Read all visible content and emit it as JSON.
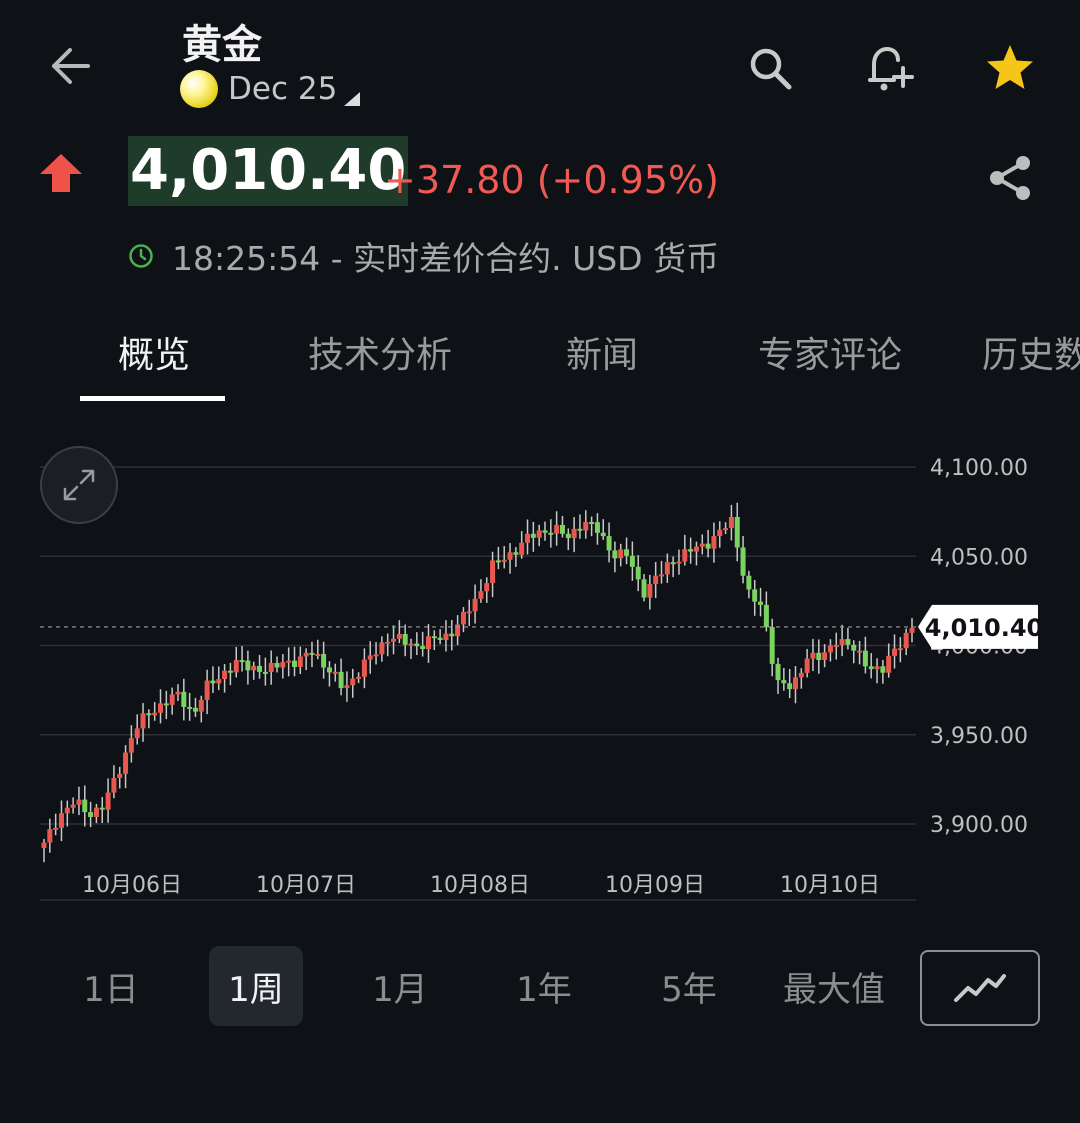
{
  "header": {
    "title": "黄金",
    "contract": "Dec 25",
    "icons": [
      "back-arrow-icon",
      "search-icon",
      "add-alert-icon",
      "star-icon"
    ]
  },
  "quote": {
    "price": "4,010.40",
    "change": "+37.80 (+0.95%)",
    "meta": "18:25:54 - 实时差价合约.  USD 货币",
    "direction": "up"
  },
  "tabs": [
    {
      "label": "概览",
      "active": true
    },
    {
      "label": "技术分析",
      "active": false
    },
    {
      "label": "新闻",
      "active": false
    },
    {
      "label": "专家评论",
      "active": false
    },
    {
      "label": "历史数据",
      "active": false
    }
  ],
  "chart_data": {
    "type": "candlestick",
    "y_ticks": [
      "4,100.00",
      "4,050.00",
      "4,000.00",
      "3,950.00",
      "3,900.00"
    ],
    "ylim": [
      3875,
      4110
    ],
    "x_ticks": [
      "10月06日",
      "10月07日",
      "10月08日",
      "10月09日",
      "10月10日"
    ],
    "last_price_label": "4,010.40",
    "last_price": 4010.4,
    "up_color": "#7bd35f",
    "down_color": "#e9584f",
    "close_path": [
      3888,
      3905,
      3912,
      3906,
      3910,
      3930,
      3952,
      3962,
      3968,
      3972,
      3962,
      3978,
      3985,
      3990,
      3988,
      3985,
      3992,
      3990,
      3998,
      3986,
      3976,
      3985,
      3995,
      4005,
      4002,
      4000,
      4003,
      4006,
      4015,
      4028,
      4045,
      4050,
      4058,
      4063,
      4066,
      4060,
      4070,
      4064,
      4052,
      4050,
      4030,
      4038,
      4048,
      4052,
      4056,
      4062,
      4070,
      4030,
      4020,
      3980,
      3975,
      3995,
      3992,
      4005,
      3998,
      3990,
      3985,
      4000,
      4010
    ]
  },
  "ranges": [
    {
      "label": "1日",
      "active": false
    },
    {
      "label": "1周",
      "active": true
    },
    {
      "label": "1月",
      "active": false
    },
    {
      "label": "1年",
      "active": false
    },
    {
      "label": "5年",
      "active": false
    },
    {
      "label": "最大值",
      "active": false
    }
  ],
  "colors": {
    "accent_up": "#f05a52",
    "price_bg": "#1f3c2a",
    "star": "#f5c518",
    "clock": "#4caf50"
  }
}
